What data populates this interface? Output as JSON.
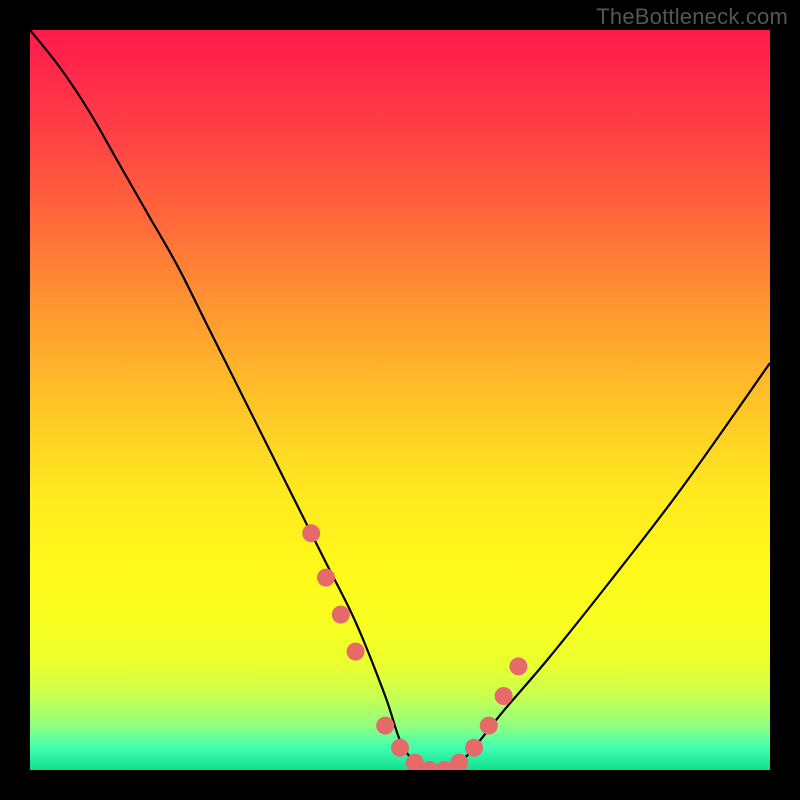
{
  "watermark": "TheBottleneck.com",
  "chart_data": {
    "type": "line",
    "title": "",
    "xlabel": "",
    "ylabel": "",
    "xlim": [
      0,
      100
    ],
    "ylim": [
      0,
      100
    ],
    "gradient_colors_top_to_bottom": [
      "#ff1a4a",
      "#ff9830",
      "#ffe820",
      "#10e090"
    ],
    "series": [
      {
        "name": "bottleneck-curve",
        "color": "#000000",
        "x": [
          0,
          4,
          8,
          12,
          16,
          20,
          24,
          28,
          32,
          36,
          40,
          44,
          48,
          50,
          52,
          54,
          56,
          58,
          60,
          64,
          70,
          78,
          88,
          100
        ],
        "y": [
          100,
          95,
          89,
          82,
          75,
          68,
          60,
          52,
          44,
          36,
          28,
          20,
          10,
          4,
          1,
          0,
          0,
          1,
          3,
          8,
          15,
          25,
          38,
          55
        ]
      },
      {
        "name": "highlight-dots",
        "color": "#e66a6a",
        "type": "scatter",
        "x": [
          38,
          40,
          42,
          44,
          48,
          50,
          52,
          54,
          56,
          58,
          60,
          62,
          64,
          66
        ],
        "y": [
          32,
          26,
          21,
          16,
          6,
          3,
          1,
          0,
          0,
          1,
          3,
          6,
          10,
          14
        ]
      }
    ]
  }
}
